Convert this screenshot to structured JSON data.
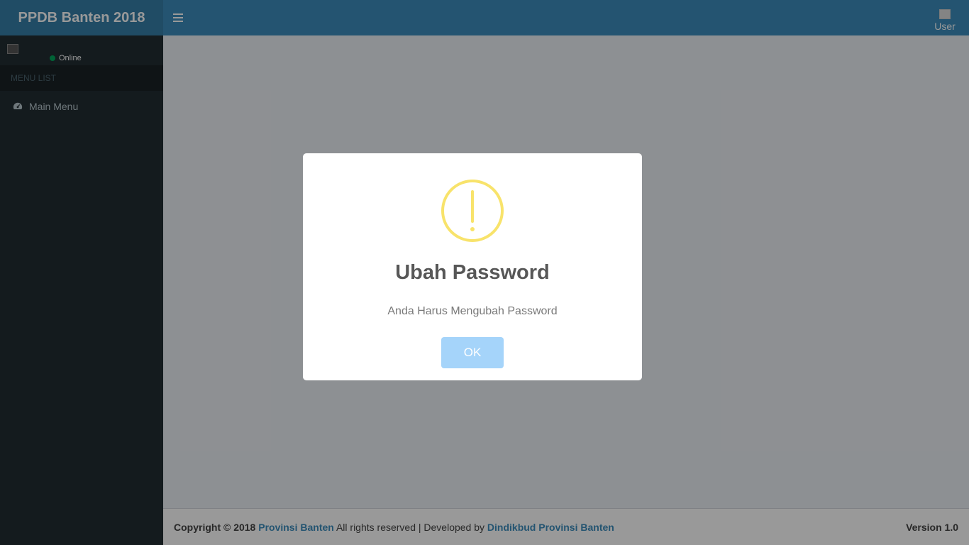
{
  "header": {
    "brand": "PPDB Banten 2018",
    "user_image_alt": "User Image"
  },
  "sidebar": {
    "status": "Online",
    "menu_header": "MENU LIST",
    "items": [
      {
        "label": "Main Menu",
        "icon": "dashboard-icon"
      }
    ]
  },
  "footer": {
    "copyright": "Copyright © 2018",
    "org_link": "Provinsi Banten",
    "rights_text": "All rights reserved | Developed by",
    "dev_link": "Dindikbud Provinsi Banten",
    "version": "Version 1.0"
  },
  "modal": {
    "icon": "warning-icon",
    "title": "Ubah Password",
    "text": "Anda Harus Mengubah Password",
    "ok_label": "OK"
  },
  "colors": {
    "navbar": "#3c8dbc",
    "logo": "#367fa9",
    "sidebar": "#222d32",
    "ok_button": "#a5d4fa",
    "warning": "#f8e36b"
  }
}
